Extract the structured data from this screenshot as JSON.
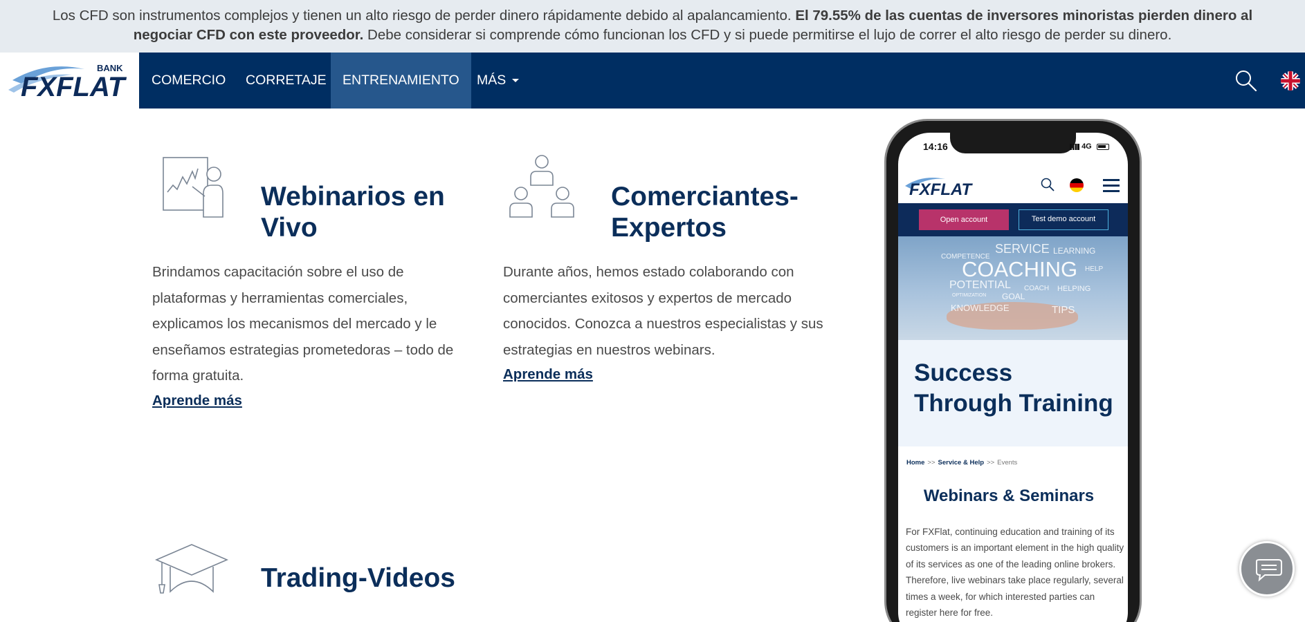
{
  "risk_banner": {
    "part1": "Los CFD son instrumentos complejos y tienen un alto riesgo de perder dinero rápidamente debido al apalancamiento. ",
    "bold": "El 79.55% de las cuentas de inversores minoristas pierden dinero al negociar CFD con este proveedor.",
    "part2": " Debe considerar si comprende cómo funcionan los CFD y si puede permitirse el lujo de correr el alto riesgo de perder su dinero."
  },
  "logo": {
    "brand": "FXFLAT",
    "sub": "BANK"
  },
  "nav": {
    "items": [
      {
        "label": "COMERCIO"
      },
      {
        "label": "CORRETAJE"
      },
      {
        "label": "ENTRENAMIENTO"
      },
      {
        "label": "MÁS"
      }
    ]
  },
  "features": [
    {
      "title_line1": "Webinarios en",
      "title_line2": "Vivo",
      "description": "Brindamos capacitación sobre el uso de plataformas y herramientas comerciales, explicamos los mecanismos del mercado y le enseñamos estrategias prometedoras – todo de forma gratuita.",
      "link": "Aprende más",
      "icon": "presentation-icon"
    },
    {
      "title_line1": "Comerciantes-",
      "title_line2": "Expertos",
      "description": "Durante años, hemos estado colaborando con comerciantes exitosos y expertos de mercado conocidos. Conozca a nuestros especialistas y sus estrategias en nuestros webinars.",
      "link": "Aprende más",
      "icon": "team-icon"
    },
    {
      "title_line1": "Trading-Videos",
      "icon": "graduation-cap-icon"
    }
  ],
  "phone": {
    "time": "14:16",
    "network": "4G",
    "logo": "FXFLAT",
    "open_account": "Open account",
    "demo_account": "Test demo account",
    "hero_words": {
      "service": "SERVICE",
      "learning": "LEARNING",
      "competence": "COMPETENCE",
      "coaching": "COACHING",
      "help": "HELP",
      "potential": "POTENTIAL",
      "coach": "COACH",
      "helping": "HELPING",
      "optimization": "OPTIMIZATION",
      "goal": "GOAL",
      "knowledge": "KNOWLEDGE",
      "tips": "TIPS"
    },
    "hero_title": "Success Through Training",
    "breadcrumb": {
      "home": "Home",
      "sep": ">>",
      "service": "Service & Help",
      "events": "Events"
    },
    "section_title": "Webinars & Seminars",
    "body": "For FXFlat, continuing education and training of its customers is an important element in the high quality of its services as one of the leading online brokers. Therefore, live webinars take place regularly, several times a week, for which interested parties can register here for free."
  },
  "colors": {
    "navy": "#002e62",
    "nav_active": "#26578c",
    "title": "#0b2e5a",
    "banner_bg": "#e6ebf0",
    "cta_pink": "#b8336a"
  }
}
